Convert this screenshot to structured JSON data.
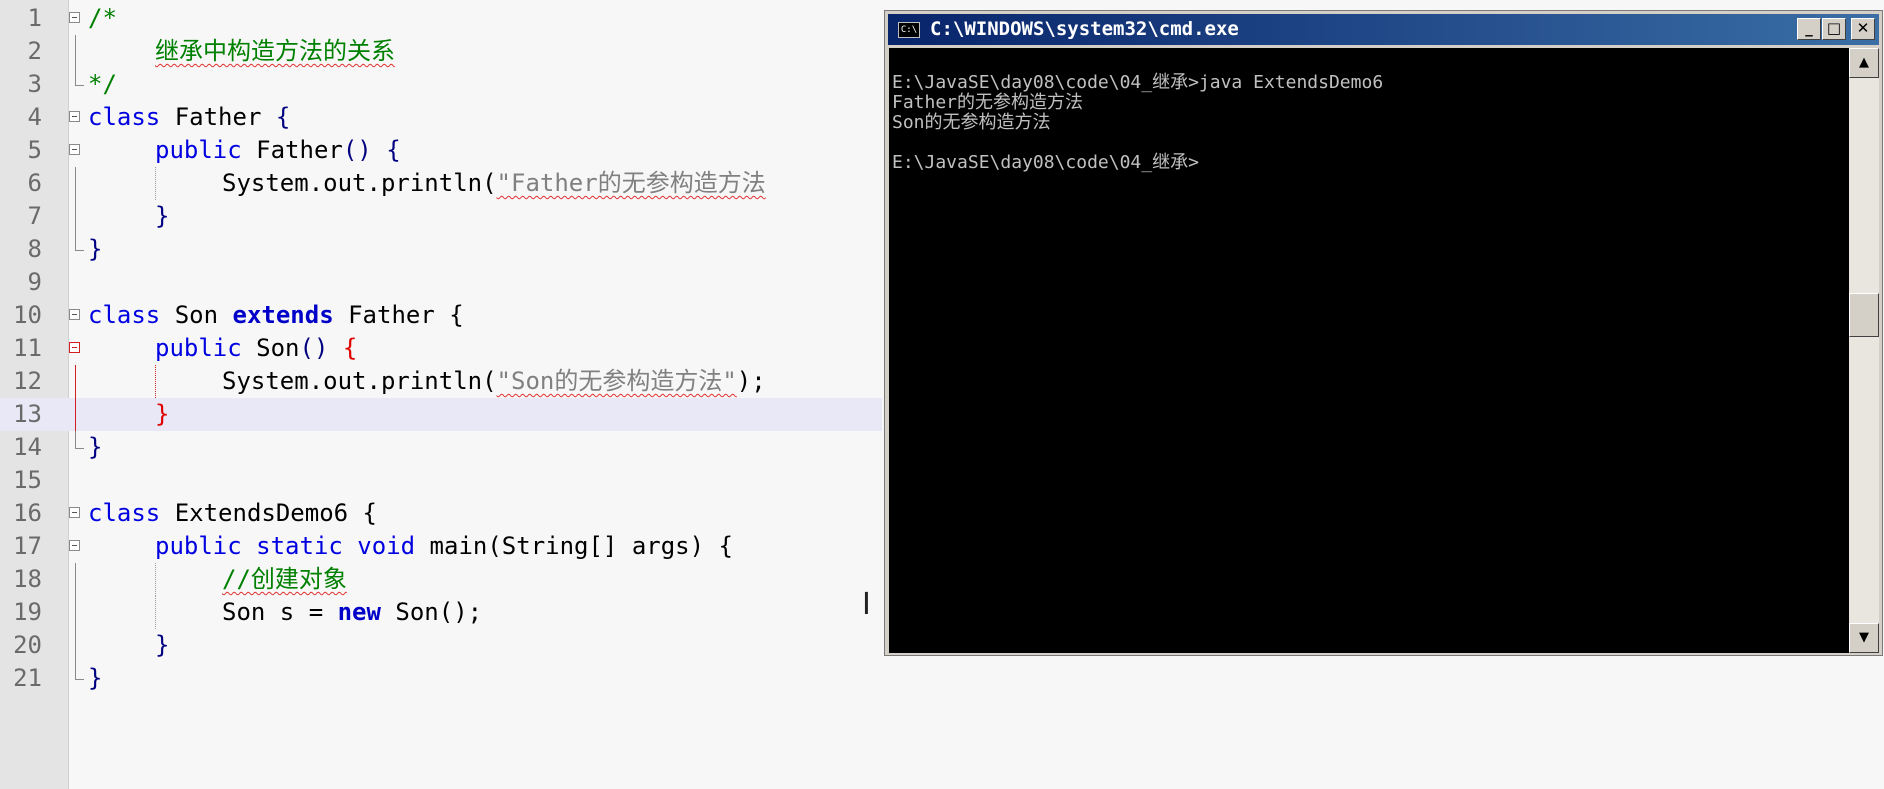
{
  "editor": {
    "lines": [
      {
        "n": "1"
      },
      {
        "n": "2"
      },
      {
        "n": "3"
      },
      {
        "n": "4"
      },
      {
        "n": "5"
      },
      {
        "n": "6"
      },
      {
        "n": "7"
      },
      {
        "n": "8"
      },
      {
        "n": "9"
      },
      {
        "n": "10"
      },
      {
        "n": "11"
      },
      {
        "n": "12"
      },
      {
        "n": "13"
      },
      {
        "n": "14"
      },
      {
        "n": "15"
      },
      {
        "n": "16"
      },
      {
        "n": "17"
      },
      {
        "n": "18"
      },
      {
        "n": "19"
      },
      {
        "n": "20"
      },
      {
        "n": "21"
      }
    ],
    "code": {
      "l1": "/*",
      "l2": "继承中构造方法的关系",
      "l3": "*/",
      "l4_kw": "class",
      "l4_name": " Father ",
      "l4_brace": "{",
      "l5_kw": "public",
      "l5_name": " Father",
      "l5_rest": "() {",
      "l6_call": "System.out.println(",
      "l6_str": "\"Father的无参构造方法",
      "l7": "}",
      "l8": "}",
      "l10_kw": "class",
      "l10_name": " Son ",
      "l10_ext": "extends",
      "l10_rest": " Father {",
      "l11_kw": "public",
      "l11_name": " Son",
      "l11_paren": "() ",
      "l11_brace": "{",
      "l12_call": "System.out.println(",
      "l12_str": "\"Son的无参构造方法\"",
      "l12_end": ");",
      "l13": "}",
      "l14": "}",
      "l16_kw": "class",
      "l16_rest": " ExtendsDemo6 {",
      "l17_kw": "public static void",
      "l17_rest": " main(String[] args) {",
      "l18": "//创建对象",
      "l19_a": "Son s = ",
      "l19_new": "new",
      "l19_b": " Son();",
      "l20": "}",
      "l21": "}"
    },
    "cursor_glyph": "I"
  },
  "cmd": {
    "title": "C:\\WINDOWS\\system32\\cmd.exe",
    "icon_text": "C:\\",
    "minimize": "_",
    "maximize": "□",
    "close": "✕",
    "output": [
      "E:\\JavaSE\\day08\\code\\04_继承>java ExtendsDemo6",
      "Father的无参构造方法",
      "Son的无参构造方法",
      "",
      "E:\\JavaSE\\day08\\code\\04_继承>"
    ],
    "scroll_up": "▲",
    "scroll_down": "▼"
  }
}
